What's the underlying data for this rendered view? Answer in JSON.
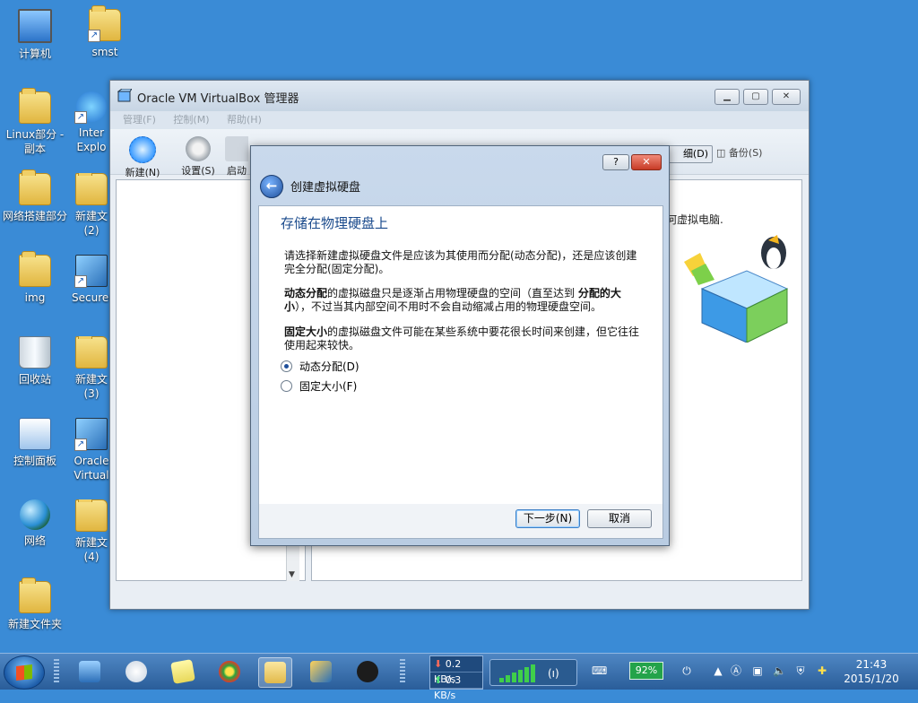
{
  "desktop": {
    "icons": [
      {
        "label": "计算机"
      },
      {
        "label": "smst"
      },
      {
        "label": "Linux部分 - 副本"
      },
      {
        "label": "Inter Explo"
      },
      {
        "label": "网络搭建部分"
      },
      {
        "label": "新建文 (2)"
      },
      {
        "label": "img"
      },
      {
        "label": "SecureC"
      },
      {
        "label": "回收站"
      },
      {
        "label": "新建文 (3)"
      },
      {
        "label": "控制面板"
      },
      {
        "label": "Oracle Virtual"
      },
      {
        "label": "网络"
      },
      {
        "label": "新建文 (4)"
      },
      {
        "label": "新建文件夹"
      }
    ]
  },
  "vbox": {
    "title": "Oracle VM VirtualBox 管理器",
    "menu": [
      "管理(F)",
      "控制(M)",
      "帮助(H)"
    ],
    "toolbar": {
      "new": "新建(N)",
      "settings": "设置(S)",
      "start": "启动"
    },
    "detail_tab": "细(D)",
    "snapshot_tab": "备份(S)",
    "welcome": "何虚拟电脑."
  },
  "dialog": {
    "title": "创建虚拟硬盘",
    "help_glyph": "?",
    "close_glyph": "✕",
    "heading": "存储在物理硬盘上",
    "p1": "请选择新建虚拟硬盘文件是应该为其使用而分配(动态分配)，还是应该创建完全分配(固定分配)。",
    "p2_bold1": "动态分配",
    "p2_mid": "的虚拟磁盘只是逐渐占用物理硬盘的空间（直至达到 ",
    "p2_bold2": "分配的大小",
    "p2_end": "），不过当其内部空间不用时不会自动缩减占用的物理硬盘空间。",
    "p3_bold": "固定大小",
    "p3_rest": "的虚拟磁盘文件可能在某些系统中要花很长时间来创建，但它往往使用起来较快。",
    "option_dynamic": "动态分配(D)",
    "option_fixed": "固定大小(F)",
    "selected": "dynamic",
    "next_button": "下一步(N)",
    "cancel_button": "取消"
  },
  "taskbar": {
    "net_down": "0.2 KB/s",
    "net_up": "0.3 KB/s",
    "battery": "92%",
    "time": "21:43",
    "date": "2015/1/20"
  }
}
